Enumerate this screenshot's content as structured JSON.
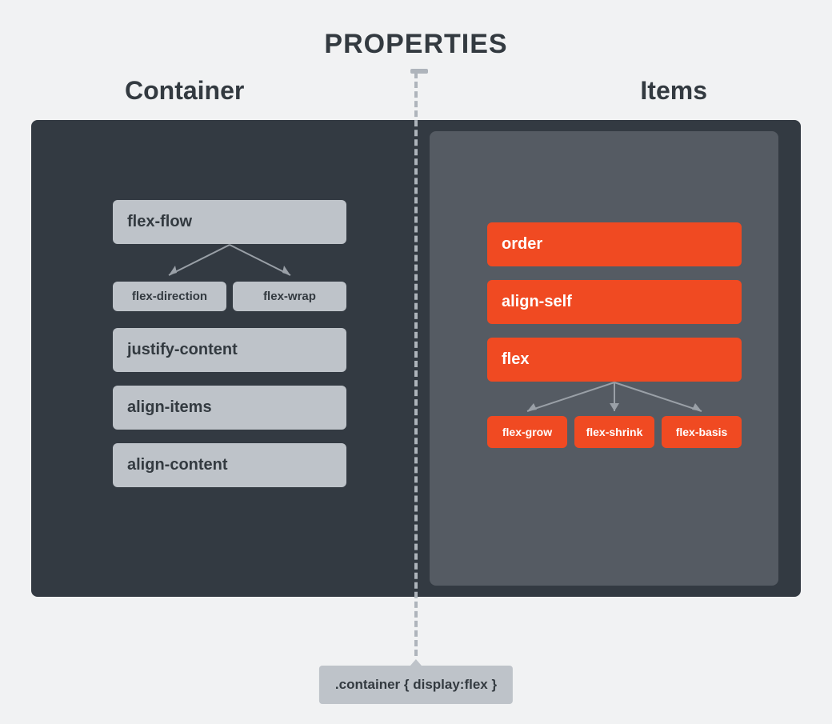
{
  "title": "PROPERTIES",
  "left_heading": "Container",
  "right_heading": "Items",
  "container": {
    "flex_flow": "flex-flow",
    "flex_direction": "flex-direction",
    "flex_wrap": "flex-wrap",
    "justify_content": "justify-content",
    "align_items": "align-items",
    "align_content": "align-content"
  },
  "items": {
    "order": "order",
    "align_self": "align-self",
    "flex": "flex",
    "flex_grow": "flex-grow",
    "flex_shrink": "flex-shrink",
    "flex_basis": "flex-basis"
  },
  "footer": ".container { display:flex }"
}
